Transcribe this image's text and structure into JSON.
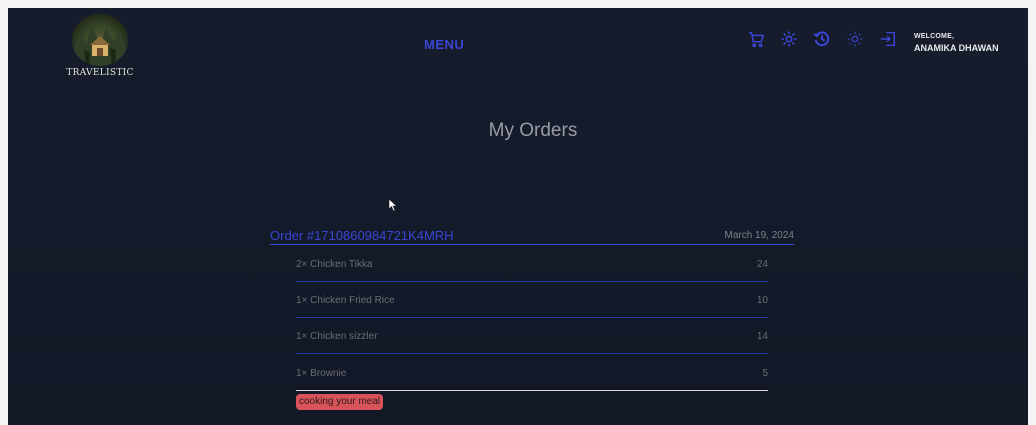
{
  "header": {
    "logo_text": "TRAVELISTIC",
    "menu_label": "MENU",
    "icons": [
      "cart-icon",
      "gear-icon",
      "history-icon",
      "sun-icon",
      "logout-icon"
    ],
    "welcome_label": "WELCOME,",
    "user_name": "ANAMIKA DHAWAN"
  },
  "main": {
    "title": "My Orders",
    "order": {
      "id": "Order #1710860984721K4MRH",
      "date": "March 19, 2024",
      "items": [
        {
          "name": "2× Chicken Tikka",
          "price": "24"
        },
        {
          "name": "1× Chicken Fried Rice",
          "price": "10"
        },
        {
          "name": "1× Chicken sizzler",
          "price": "14"
        },
        {
          "name": "1× Brownie",
          "price": "5"
        }
      ],
      "status": "cooking your meal"
    }
  },
  "colors": {
    "accent": "#3b46d6",
    "background": "#141a29",
    "status": "#d9545a"
  }
}
